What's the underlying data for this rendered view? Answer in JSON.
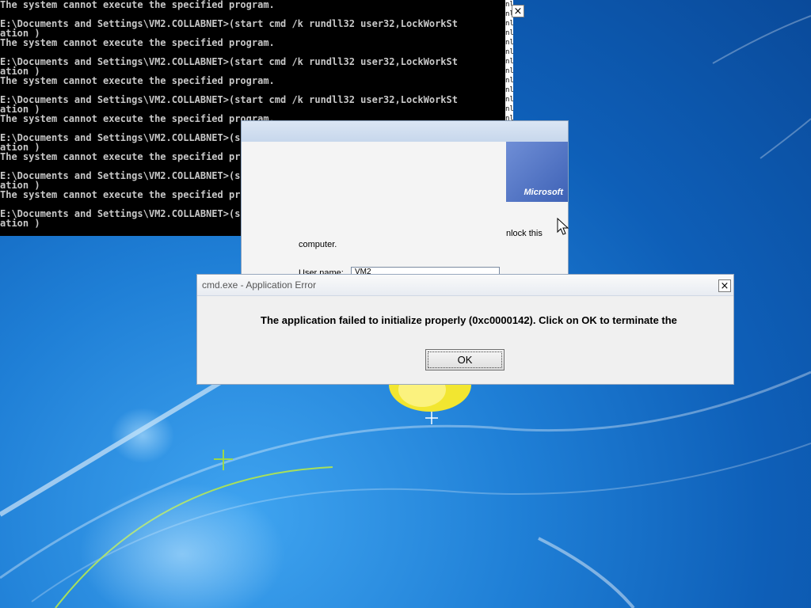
{
  "console": {
    "lines": [
      "The system cannot execute the specified program.",
      "",
      "E:\\Documents and Settings\\VM2.COLLABNET>(start cmd /k rundll32 user32,LockWorkSt",
      "ation )",
      "The system cannot execute the specified program.",
      "",
      "E:\\Documents and Settings\\VM2.COLLABNET>(start cmd /k rundll32 user32,LockWorkSt",
      "ation )",
      "The system cannot execute the specified program.",
      "",
      "E:\\Documents and Settings\\VM2.COLLABNET>(start cmd /k rundll32 user32,LockWorkSt",
      "ation )",
      "The system cannot execute the specified program.",
      "",
      "E:\\Documents and Settings\\VM2.COLLABNET>(start cmd /k rundll32 user32,LockWorkSt",
      "ation )",
      "The system cannot execute the specified program.",
      "",
      "E:\\Documents and Settings\\VM2.COLLABNET>(start cmd /k rundll32 user32,LockWorkSt",
      "ation )",
      "The system cannot execute the specified program.",
      "",
      "E:\\Documents and Settings\\VM2.COLLABNET>(start cmd /k rundll32 user32,LockWorkSt",
      "ation )"
    ],
    "strip_text": "nlo\nnlo\nnlo\nnlo\nnlo\nnlo\nnlo\nnlo\nnlo\nnlo\nnlo\nnlo\nnlo\nnlo\nnlo\nnlo\nnlo\nnlo\nnlo\nnlo\nnlo\nnlo\nnlo\nnlo",
    "close_label": "×",
    "text_color": "#c8c8c8",
    "background": "#000000"
  },
  "lock_dialog": {
    "brand": "Microsoft",
    "side_text": "nlock this",
    "body_text": "computer.",
    "user_label": "User name:",
    "user_value": "VM2"
  },
  "error_dialog": {
    "title": "cmd.exe - Application Error",
    "message": "The application failed to initialize properly (0xc0000142). Click on OK to terminate the",
    "ok_label": "OK",
    "close_label": "×"
  },
  "desktop": {
    "background_color": "#1a6fd0"
  }
}
